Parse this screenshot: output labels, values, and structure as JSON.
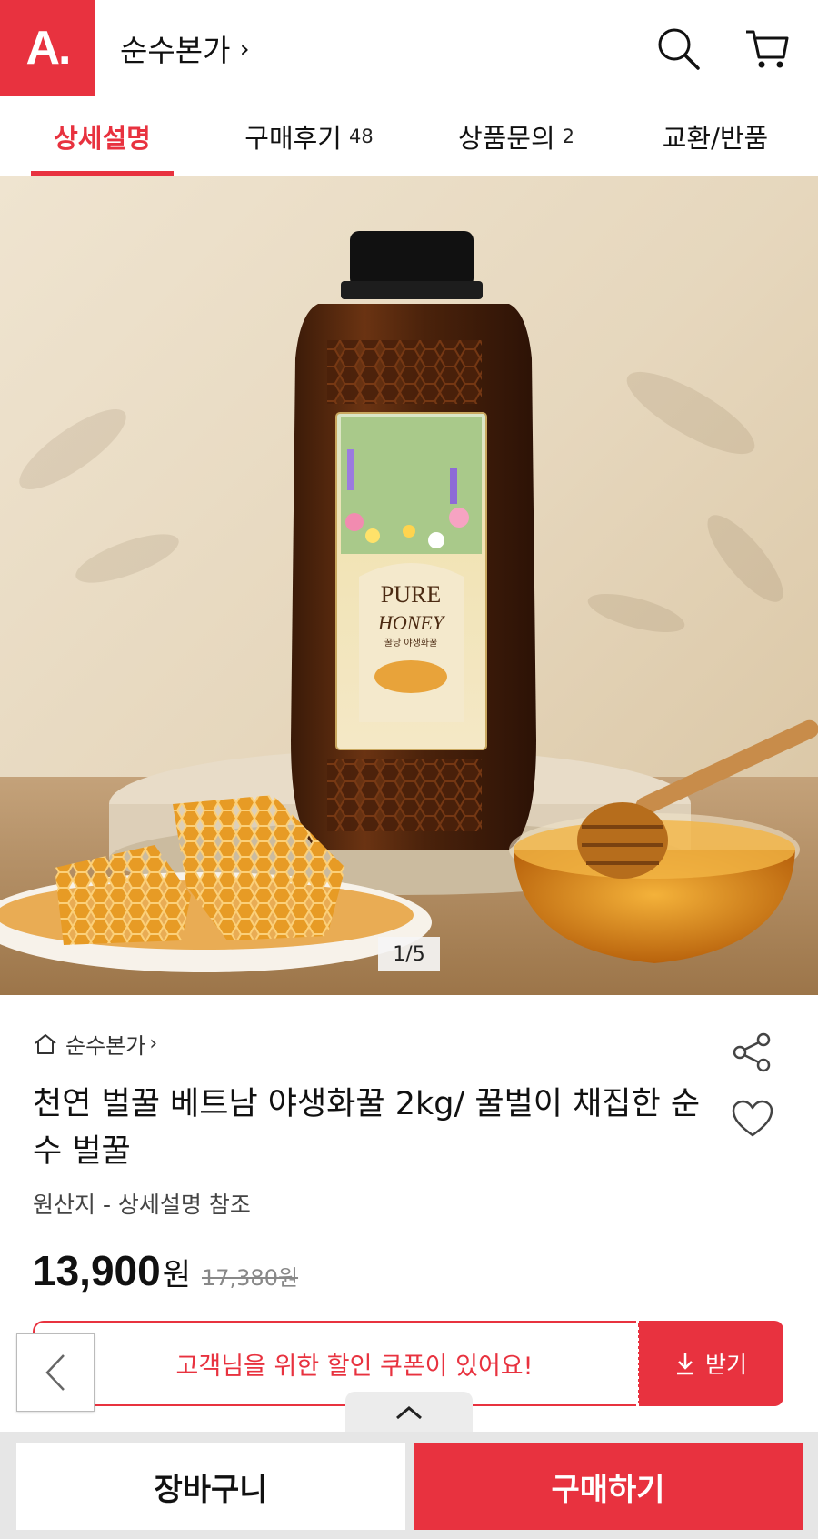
{
  "header": {
    "logo_text": "A.",
    "store_name": "순수본가",
    "chevron": "›",
    "icons": [
      "search-icon",
      "cart-icon"
    ],
    "brand_color": "#e8323f"
  },
  "tabs": [
    {
      "label": "상세설명",
      "count": "",
      "active": true
    },
    {
      "label": "구매후기",
      "count": "48",
      "active": false
    },
    {
      "label": "상품문의",
      "count": "2",
      "active": false
    },
    {
      "label": "교환/반품",
      "count": "",
      "active": false
    }
  ],
  "hero": {
    "pager": "1/5",
    "label_line1": "PURE",
    "label_line2": "HONEY",
    "label_sub": "꿀당 야생화꿀"
  },
  "product": {
    "brand": "순수본가",
    "chevron": "›",
    "title": "천연 벌꿀 베트남 야생화꿀 2kg/ 꿀벌이 채집한 순수 벌꿀",
    "origin": "원산지 - 상세설명 참조",
    "price": "13,900",
    "price_unit": "원",
    "original_price": "17,380원"
  },
  "coupon": {
    "message": "고객님을 위한 할인 쿠폰이 있어요!",
    "button_label": "받기"
  },
  "actions": {
    "cart_label": "장바구니",
    "buy_label": "구매하기"
  }
}
